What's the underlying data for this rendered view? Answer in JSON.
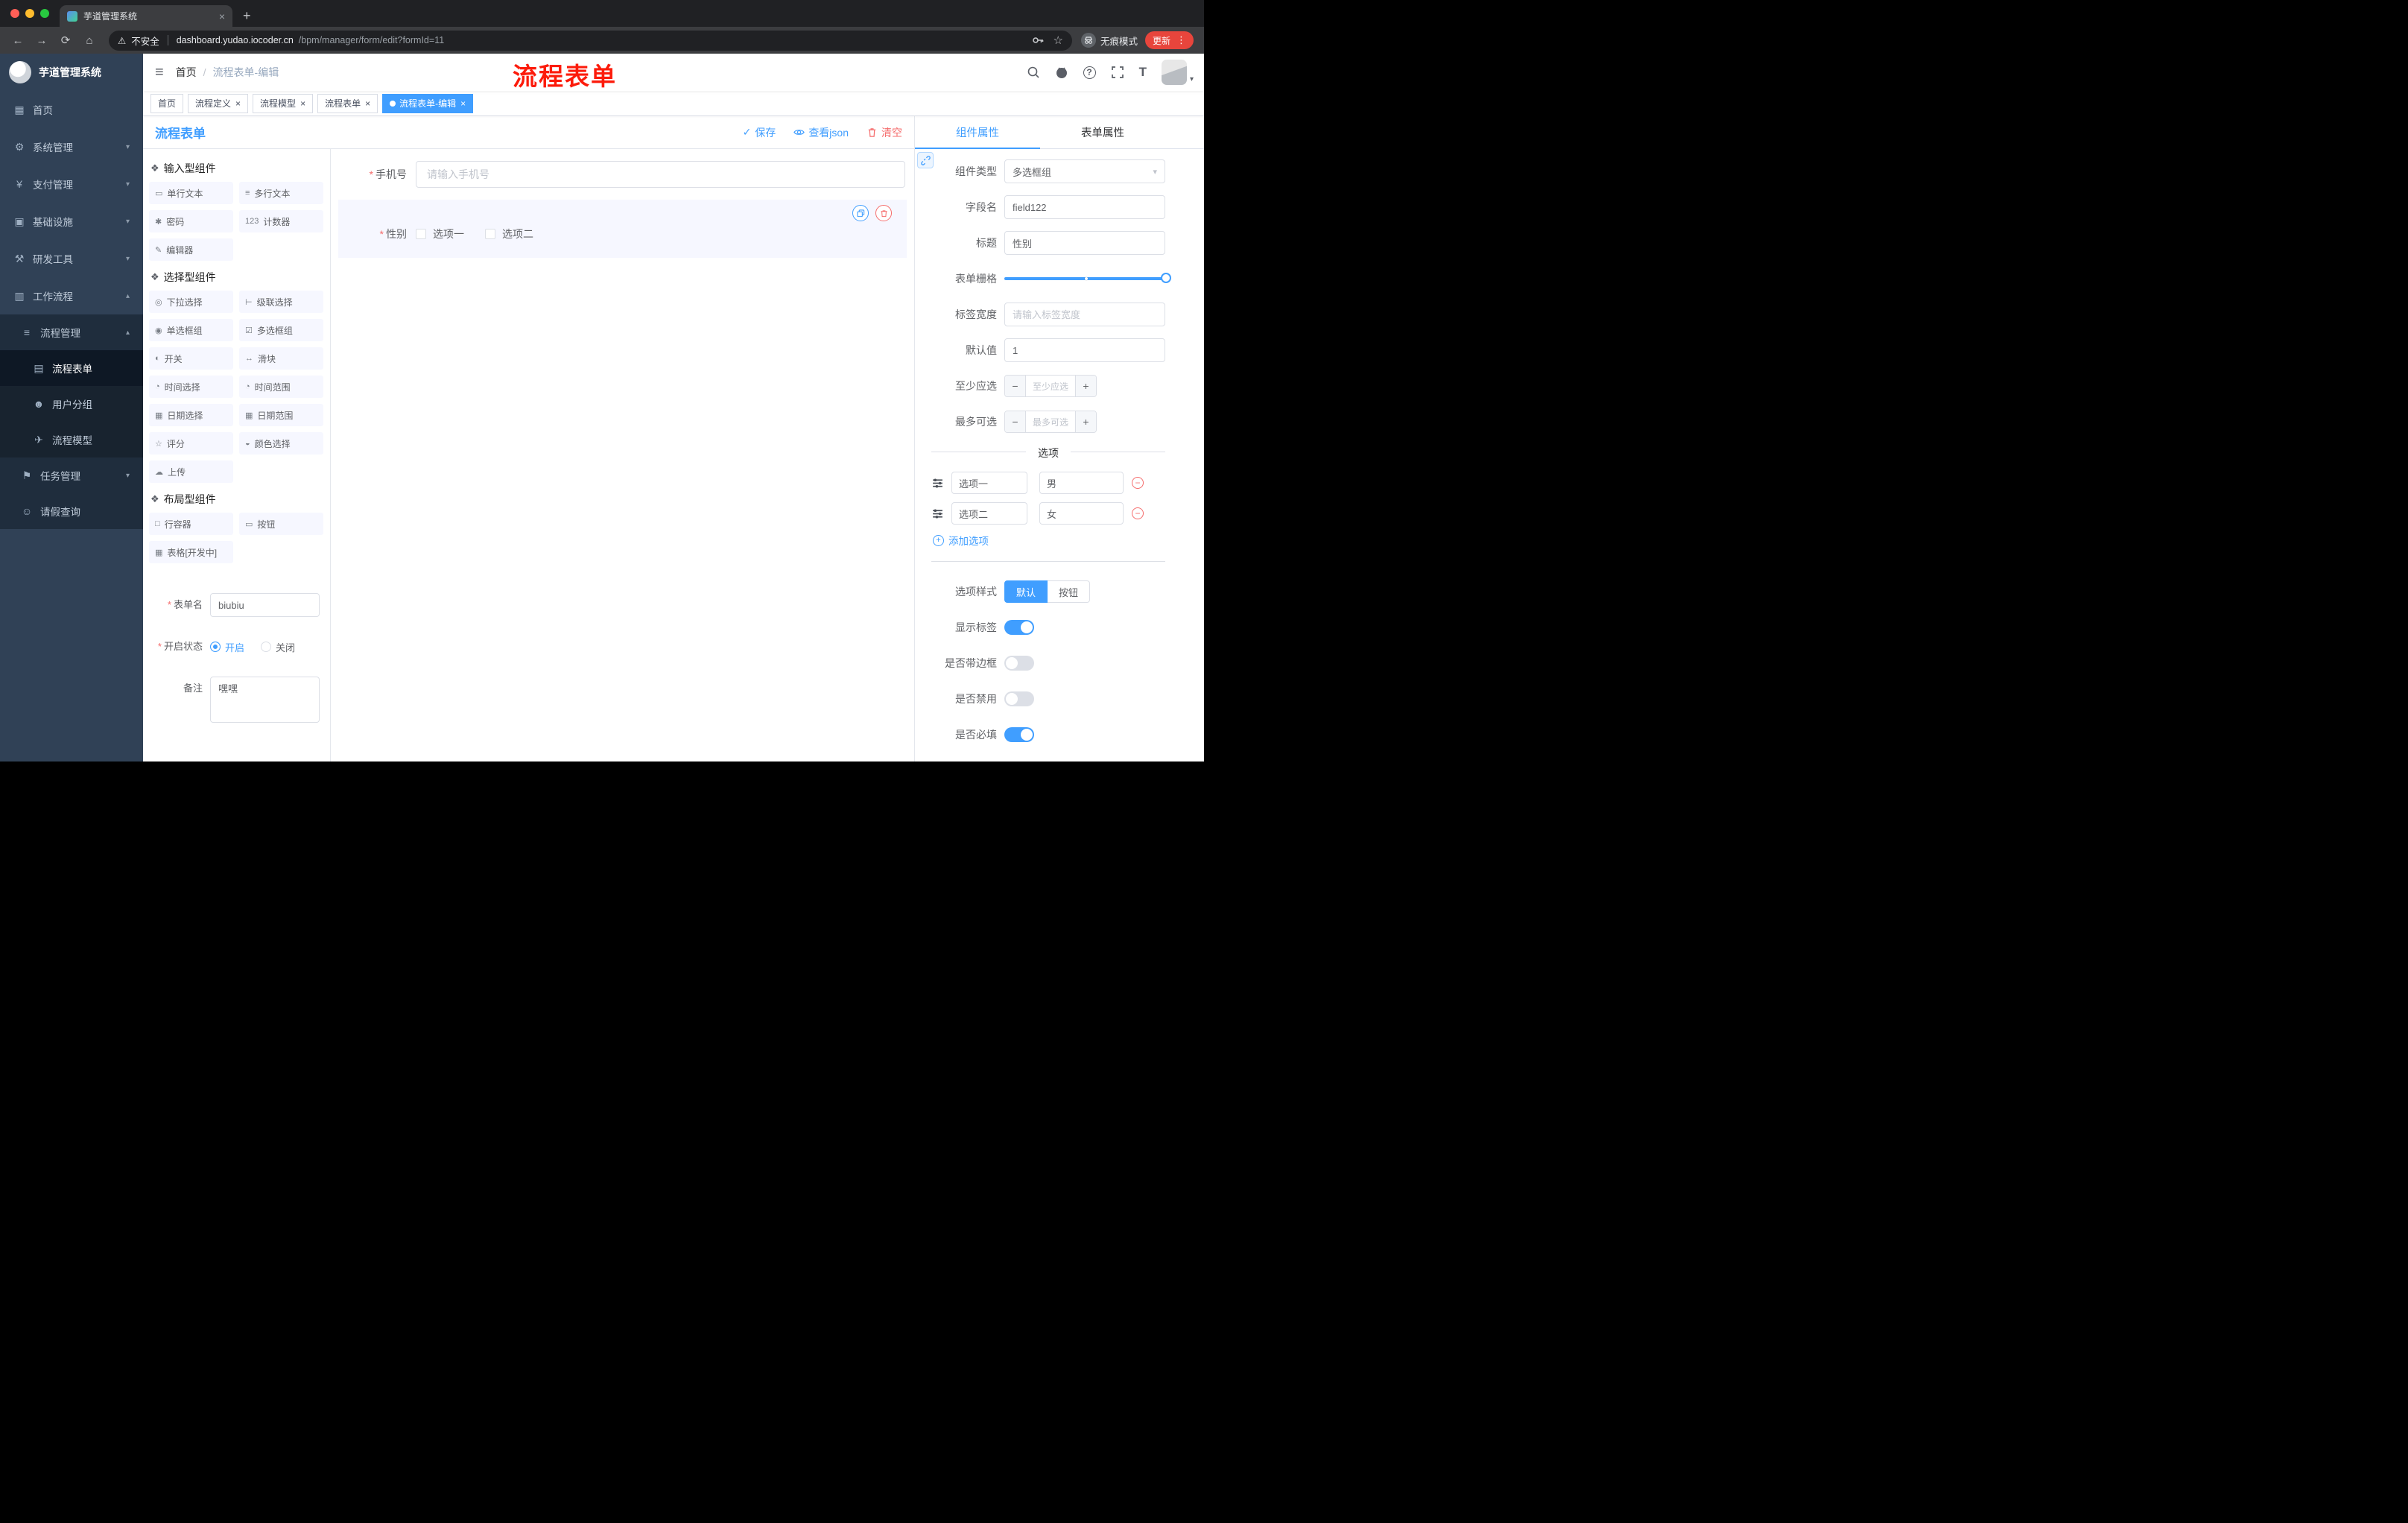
{
  "browser": {
    "tab_title": "芋道管理系统",
    "security_label": "不安全",
    "url_host": "dashboard.yudao.iocoder.cn",
    "url_path": "/bpm/manager/form/edit?formId=11",
    "incognito_label": "无痕模式",
    "update_label": "更新"
  },
  "annotation": {
    "text": "流程表单",
    "color": "#FC1B0B"
  },
  "colors": {
    "accent": "#409EFF",
    "danger": "#F56C6C",
    "sidebar_bg": "#304156",
    "active_tag": "#409EFF"
  },
  "icons": {
    "close": "×",
    "new_tab": "+",
    "back": "←",
    "forward": "→",
    "reload": "⟳",
    "home": "⌂",
    "warning": "⚠",
    "star": "☆",
    "menu_dots": "⋮",
    "hamburger": "≡",
    "breadcrumb_sep": "/",
    "question": "?",
    "chevron_down": "▾",
    "chevron_up": "▴",
    "caret_down": "▾",
    "check": "✓",
    "minus": "−",
    "plus": "+",
    "group": "❖",
    "select_caret": "▾",
    "size": "T"
  },
  "sidebar": {
    "logo_title": "芋道管理系统",
    "items": [
      {
        "icon": "▦",
        "label": "首页"
      },
      {
        "icon": "⚙",
        "label": "系统管理"
      },
      {
        "icon": "¥",
        "label": "支付管理"
      },
      {
        "icon": "▣",
        "label": "基础设施"
      },
      {
        "icon": "⚒",
        "label": "研发工具"
      },
      {
        "icon": "▥",
        "label": "工作流程"
      },
      {
        "icon": "≡",
        "label": "流程管理"
      },
      {
        "icon": "▤",
        "label": "流程表单"
      },
      {
        "icon": "☻",
        "label": "用户分组"
      },
      {
        "icon": "✈",
        "label": "流程模型"
      },
      {
        "icon": "⚑",
        "label": "任务管理"
      },
      {
        "icon": "☺",
        "label": "请假查询"
      }
    ]
  },
  "navbar": {
    "breadcrumb": [
      "首页",
      "流程表单-编辑"
    ]
  },
  "tags": [
    {
      "label": "首页"
    },
    {
      "label": "流程定义"
    },
    {
      "label": "流程模型"
    },
    {
      "label": "流程表单"
    },
    {
      "label": "流程表单-编辑"
    }
  ],
  "designer": {
    "title": "流程表单",
    "save": "保存",
    "view_json": "查看json",
    "clear": "清空"
  },
  "palette": {
    "groups": [
      {
        "title": "输入型组件",
        "items": [
          {
            "icon": "▭",
            "label": "单行文本"
          },
          {
            "icon": "≡",
            "label": "多行文本"
          },
          {
            "icon": "✱",
            "label": "密码"
          },
          {
            "icon": "123",
            "label": "计数器"
          },
          {
            "icon": "✎",
            "label": "编辑器"
          }
        ]
      },
      {
        "title": "选择型组件",
        "items": [
          {
            "icon": "◎",
            "label": "下拉选择"
          },
          {
            "icon": "⊢",
            "label": "级联选择"
          },
          {
            "icon": "◉",
            "label": "单选框组"
          },
          {
            "icon": "☑",
            "label": "多选框组"
          },
          {
            "icon": "◐",
            "label": "开关"
          },
          {
            "icon": "↔",
            "label": "滑块"
          },
          {
            "icon": "◔",
            "label": "时间选择"
          },
          {
            "icon": "◔",
            "label": "时间范围"
          },
          {
            "icon": "▦",
            "label": "日期选择"
          },
          {
            "icon": "▦",
            "label": "日期范围"
          },
          {
            "icon": "☆",
            "label": "评分"
          },
          {
            "icon": "◒",
            "label": "颜色选择"
          },
          {
            "icon": "☁",
            "label": "上传"
          }
        ]
      },
      {
        "title": "布局型组件",
        "items": [
          {
            "icon": "□",
            "label": "行容器"
          },
          {
            "icon": "▭",
            "label": "按钮"
          },
          {
            "icon": "▦",
            "label": "表格[开发中]"
          }
        ]
      }
    ]
  },
  "meta": {
    "form_name_label": "表单名",
    "form_name_value": "biubiu",
    "status_label": "开启状态",
    "status_on": "开启",
    "status_off": "关闭",
    "remark_label": "备注",
    "remark_value": "嘿嘿"
  },
  "canvas": {
    "phone": {
      "label": "手机号",
      "placeholder": "请输入手机号"
    },
    "gender": {
      "label": "性别",
      "options": [
        "选项一",
        "选项二"
      ]
    }
  },
  "panel": {
    "tabs": [
      "组件属性",
      "表单属性"
    ],
    "rows": {
      "component_type": {
        "label": "组件类型",
        "value": "多选框组"
      },
      "field_name": {
        "label": "字段名",
        "value": "field122"
      },
      "title": {
        "label": "标题",
        "value": "性别"
      },
      "grid": {
        "label": "表单栅格"
      },
      "label_width": {
        "label": "标签宽度",
        "placeholder": "请输入标签宽度"
      },
      "default_value": {
        "label": "默认值",
        "value": "1"
      },
      "min_select": {
        "label": "至少应选",
        "placeholder": "至少应选"
      },
      "max_select": {
        "label": "最多可选",
        "placeholder": "最多可选"
      }
    },
    "options_divider": "选项",
    "options": [
      {
        "label": "选项一",
        "value": "男"
      },
      {
        "label": "选项二",
        "value": "女"
      }
    ],
    "add_option": "添加选项",
    "option_style": {
      "label": "选项样式",
      "choices": [
        "默认",
        "按钮"
      ]
    },
    "switches": [
      {
        "label": "显示标签",
        "on": true
      },
      {
        "label": "是否带边框",
        "on": false
      },
      {
        "label": "是否禁用",
        "on": false
      },
      {
        "label": "是否必填",
        "on": true
      }
    ]
  }
}
